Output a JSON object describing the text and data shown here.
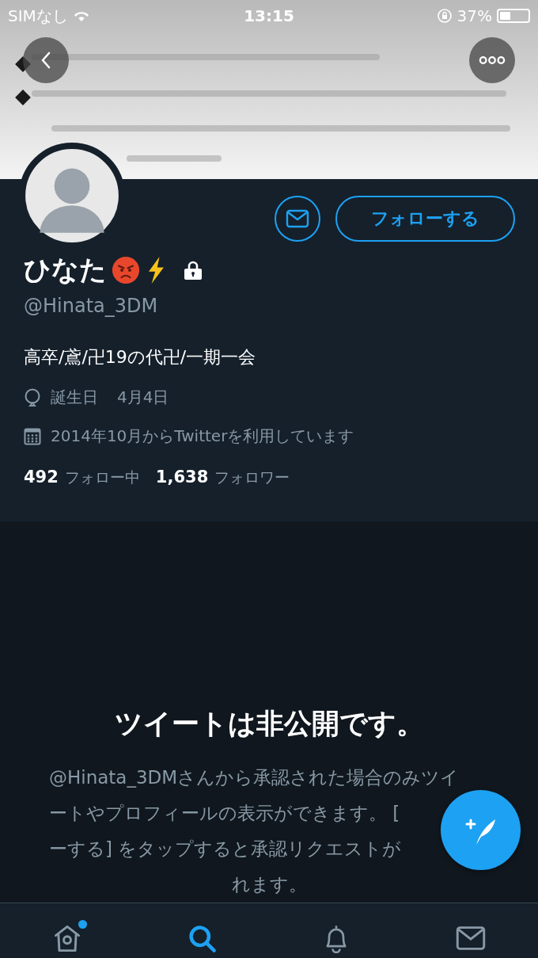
{
  "status_bar": {
    "carrier": "SIMなし",
    "time": "13:15",
    "battery": "37%"
  },
  "profile": {
    "name": "ひなた",
    "locked": true,
    "handle": "@Hinata_3DM",
    "bio": "高卒/鳶/卍19の代卍/一期一会",
    "birthday_label": "誕生日",
    "birthday": "4月4日",
    "joined": "2014年10月からTwitterを利用しています",
    "following_count": "492",
    "following_label": "フォロー中",
    "followers_count": "1,638",
    "followers_label": "フォロワー",
    "follow_button": "フォローする"
  },
  "private_notice": {
    "title": "ツイートは非公開です。",
    "lines": [
      "@Hinata_3DMさんから承認された場合のみツイ",
      "ートやプロフィールの表示ができます。 [",
      "ーする] をタップすると承認リクエストが",
      "れます。"
    ]
  },
  "tab_bar": {
    "tabs": [
      {
        "kind": "home",
        "selected": false,
        "badge": true
      },
      {
        "kind": "search",
        "selected": true,
        "badge": false
      },
      {
        "kind": "notifications",
        "selected": false,
        "badge": false
      },
      {
        "kind": "messages",
        "selected": false,
        "badge": false
      }
    ]
  }
}
